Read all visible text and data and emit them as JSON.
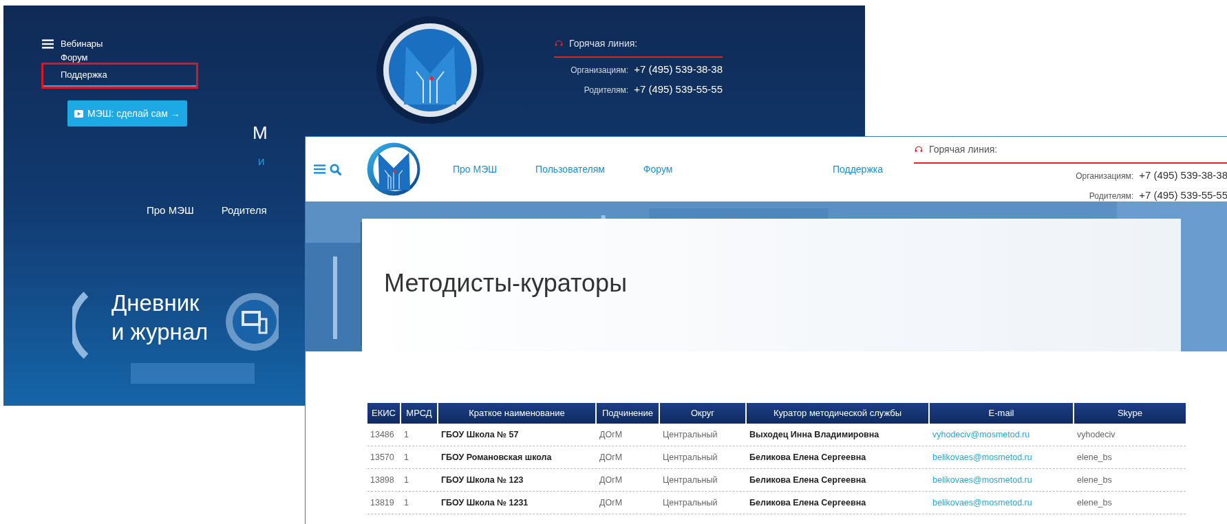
{
  "back_page": {
    "menu_items": [
      {
        "label": "Вебинары",
        "highlighted": false
      },
      {
        "label": "Форум",
        "highlighted": false
      },
      {
        "label": "Поддержка",
        "highlighted": true
      }
    ],
    "diy_button": "МЭШ: сделай сам →",
    "title_fragment": "М",
    "subtitle_fragment": "И",
    "nav": [
      "Про МЭШ",
      "Родителя"
    ],
    "hotline": {
      "title": "Горячая линия:",
      "rows": [
        {
          "label": "Организациям:",
          "phone": "+7 (495) 539-38-38"
        },
        {
          "label": "Родителям:",
          "phone": "+7 (495) 539-55-55"
        }
      ]
    },
    "banner": {
      "lines": [
        "Дневник",
        "и журнал"
      ]
    }
  },
  "front_page": {
    "nav": [
      {
        "label": "Про МЭШ",
        "kind": "left"
      },
      {
        "label": "Пользователям",
        "kind": "left"
      },
      {
        "label": "Форум",
        "kind": "left"
      },
      {
        "label": "Поддержка",
        "kind": "right"
      }
    ],
    "hotline": {
      "title": "Горячая линия:",
      "rows": [
        {
          "label": "Организациям:",
          "phone": "+7 (495) 539-38-38"
        },
        {
          "label": "Родителям:",
          "phone": "+7 (495) 539-55-55"
        }
      ]
    },
    "page_title": "Методисты-кураторы",
    "table": {
      "columns": [
        {
          "label": "ЕКИС",
          "kind": "plain"
        },
        {
          "label": "МРСД",
          "kind": "plain"
        },
        {
          "label": "Краткое наименование",
          "kind": "bold"
        },
        {
          "label": "Подчинение",
          "kind": "plain"
        },
        {
          "label": "Округ",
          "kind": "plain"
        },
        {
          "label": "Куратор методической службы",
          "kind": "bold"
        },
        {
          "label": "E-mail",
          "kind": "link"
        },
        {
          "label": "Skype",
          "kind": "plain"
        }
      ],
      "rows": [
        [
          "13486",
          "1",
          "ГБОУ Школа № 57",
          "ДОгМ",
          "Центральный",
          "Выходец Инна Владимировна",
          "vyhodeciv@mosmetod.ru",
          "vyhodeciv"
        ],
        [
          "13570",
          "1",
          "ГБОУ Романовская школа",
          "ДОгМ",
          "Центральный",
          "Беликова Елена Сергеевна",
          "belikovaes@mosmetod.ru",
          "elene_bs"
        ],
        [
          "13898",
          "1",
          "ГБОУ Школа № 123",
          "ДОгМ",
          "Центральный",
          "Беликова Елена Сергеевна",
          "belikovaes@mosmetod.ru",
          "elene_bs"
        ],
        [
          "13819",
          "1",
          "ГБОУ Школа № 1231",
          "ДОгМ",
          "Центральный",
          "Беликова Елена Сергеевна",
          "belikovaes@mosmetod.ru",
          "elene_bs"
        ]
      ]
    }
  }
}
